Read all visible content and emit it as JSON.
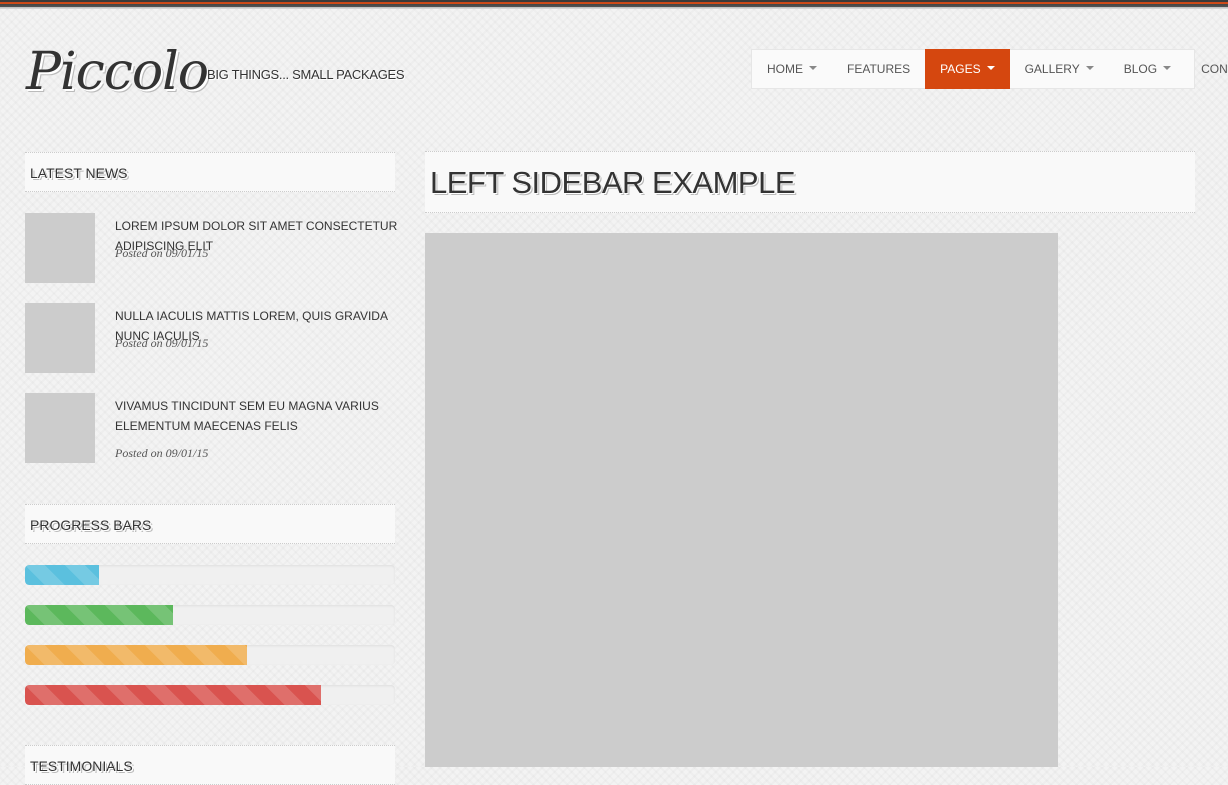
{
  "brand": {
    "logo": "Piccolo",
    "tagline": "BIG THINGS... SMALL PACKAGES"
  },
  "nav": {
    "items": [
      {
        "label": "HOME",
        "dropdown": true,
        "active": false
      },
      {
        "label": "FEATURES",
        "dropdown": false,
        "active": false
      },
      {
        "label": "PAGES",
        "dropdown": true,
        "active": true
      },
      {
        "label": "GALLERY",
        "dropdown": true,
        "active": false
      },
      {
        "label": "BLOG",
        "dropdown": true,
        "active": false
      },
      {
        "label": "CONTACT",
        "dropdown": false,
        "active": false
      }
    ],
    "active_color": "#d5470f"
  },
  "sidebar": {
    "latest_news": {
      "title": "LATEST NEWS",
      "items": [
        {
          "title": "LOREM IPSUM DOLOR SIT AMET CONSECTETUR ADIPISCING ELIT",
          "date": "Posted on 09/01/15"
        },
        {
          "title": "NULLA IACULIS MATTIS LOREM, QUIS GRAVIDA NUNC IACULIS",
          "date": "Posted on 09/01/15"
        },
        {
          "title": "VIVAMUS TINCIDUNT SEM EU MAGNA VARIUS ELEMENTUM MAECENAS FELIS",
          "date": "Posted on 09/01/15"
        }
      ]
    },
    "progress_bars": {
      "title": "PROGRESS BARS",
      "bars": [
        {
          "percent": 20,
          "color": "#5bc0de"
        },
        {
          "percent": 40,
          "color": "#5cb85c"
        },
        {
          "percent": 60,
          "color": "#f0ad4e"
        },
        {
          "percent": 80,
          "color": "#d9534f"
        }
      ]
    },
    "testimonials": {
      "title": "TESTIMONIALS"
    }
  },
  "main": {
    "title": "LEFT SIDEBAR EXAMPLE"
  }
}
